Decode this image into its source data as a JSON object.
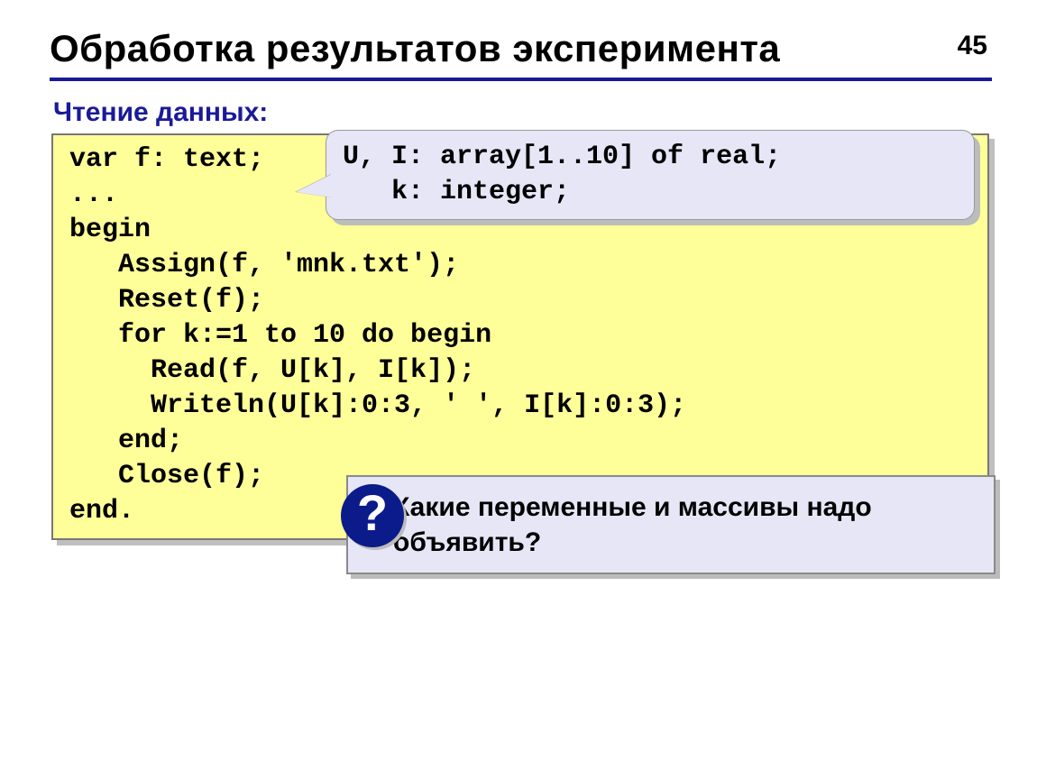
{
  "page_number": "45",
  "title": "Обработка результатов эксперимента",
  "subtitle": "Чтение данных:",
  "code": "var f: text;\n...\nbegin\n   Assign(f, 'mnk.txt');\n   Reset(f);\n   for k:=1 to 10 do begin\n     Read(f, U[k], I[k]);\n     Writeln(U[k]:0:3, ' ', I[k]:0:3);\n   end;\n   Close(f);\nend.",
  "callout": "U, I: array[1..10] of real;\n   k: integer;",
  "question_mark": "?",
  "question_text": "Какие переменные и массивы надо объявить?"
}
